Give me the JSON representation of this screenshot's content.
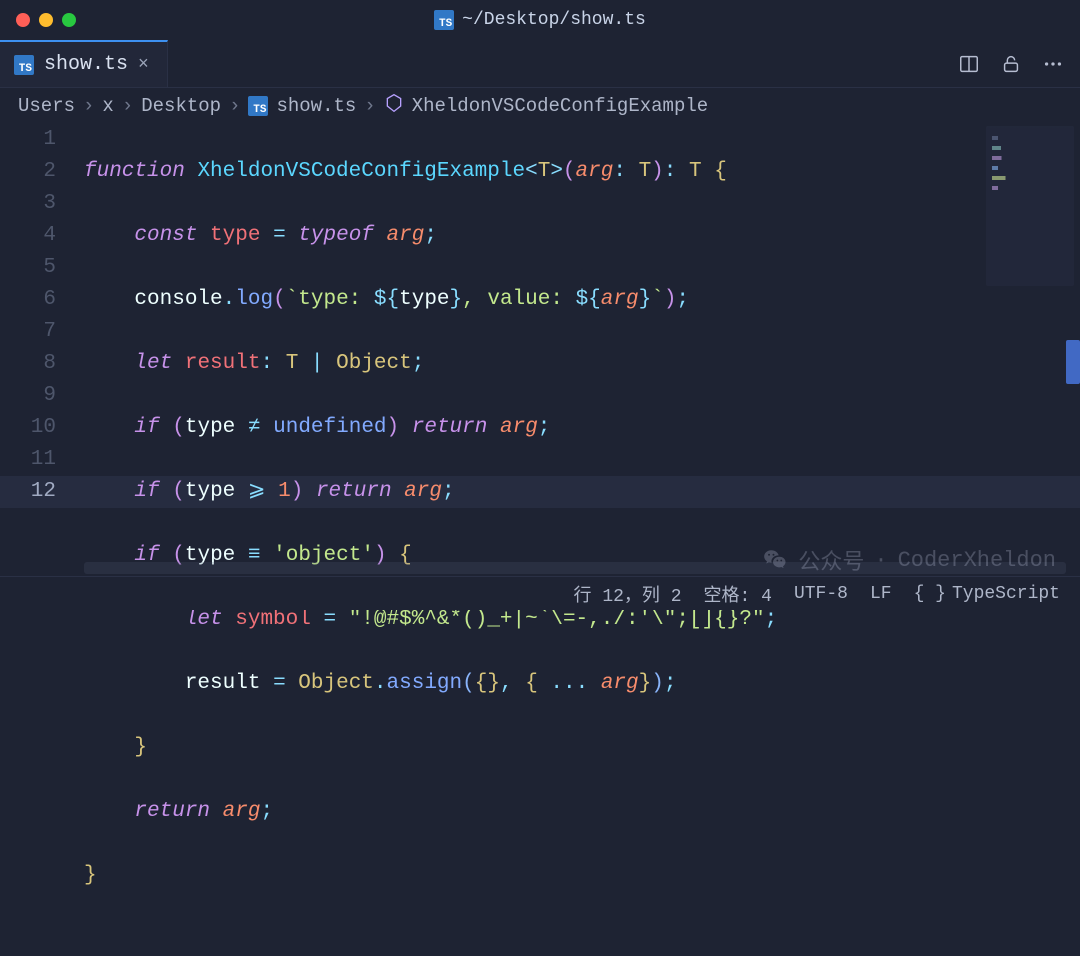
{
  "window": {
    "title": "~/Desktop/show.ts"
  },
  "tab": {
    "filename": "show.ts",
    "close_glyph": "×"
  },
  "breadcrumb": {
    "segments": [
      "Users",
      "x",
      "Desktop"
    ],
    "file": "show.ts",
    "symbol": "XheldonVSCodeConfigExample"
  },
  "editor": {
    "line_count": 12,
    "current_line": 12,
    "line_numbers": [
      "1",
      "2",
      "3",
      "4",
      "5",
      "6",
      "7",
      "8",
      "9",
      "10",
      "11",
      "12"
    ]
  },
  "code": {
    "l1": {
      "kw1": "function",
      "name": "XheldonVSCodeConfigExample",
      "t": "T",
      "param": "arg",
      "ret": "T"
    },
    "l2": {
      "kw": "const",
      "var": "type",
      "op": "=",
      "kw2": "typeof",
      "param": "arg"
    },
    "l3": {
      "obj": "console",
      "method": "log",
      "tpl_a": "`type: ",
      "tpl_b": ", value: ",
      "tpl_c": "`",
      "iv1": "type",
      "iv2": "arg"
    },
    "l4": {
      "kw": "let",
      "var": "result",
      "t": "T",
      "obj": "Object"
    },
    "l5": {
      "kw": "if",
      "var": "type",
      "op": "≠",
      "undef": "undefined",
      "ret": "return",
      "param": "arg"
    },
    "l6": {
      "kw": "if",
      "var": "type",
      "op": "⩾",
      "num": "1",
      "ret": "return",
      "param": "arg"
    },
    "l7": {
      "kw": "if",
      "var": "type",
      "op": "≡",
      "str": "'object'"
    },
    "l8": {
      "kw": "let",
      "var": "symbol",
      "op": "=",
      "str": "\"!@#$%^&*()_+|~`\\=-,./:'\\\";[]{}?\""
    },
    "l9": {
      "var": "result",
      "op": "=",
      "obj": "Object",
      "method": "assign",
      "param": "arg"
    },
    "l11": {
      "kw": "return",
      "param": "arg"
    }
  },
  "status": {
    "cursor": "行 12，列 2",
    "spaces": "空格: 4",
    "encoding": "UTF-8",
    "eol": "LF",
    "lang": "TypeScript"
  },
  "watermark": {
    "label": "公众号",
    "dot": "·",
    "name": "CoderXheldon"
  }
}
